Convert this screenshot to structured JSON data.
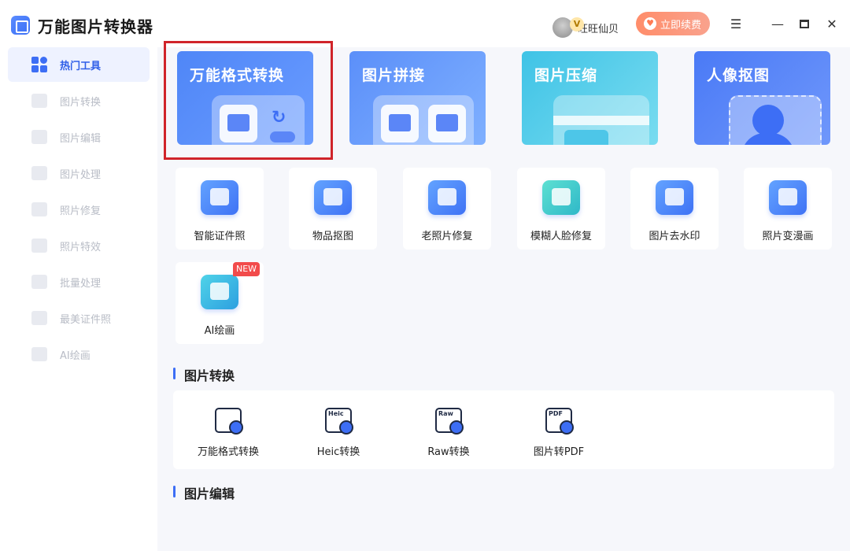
{
  "app": {
    "title": "万能图片转换器"
  },
  "header": {
    "vip_badge": "V",
    "username": "旺旺仙贝",
    "renew_label": "立即续费"
  },
  "sidebar": {
    "items": [
      {
        "label": "热门工具",
        "icon": "grid-icon",
        "active": true
      },
      {
        "label": "图片转换",
        "icon": "image-convert-icon"
      },
      {
        "label": "图片编辑",
        "icon": "image-edit-icon"
      },
      {
        "label": "图片处理",
        "icon": "image-process-icon"
      },
      {
        "label": "照片修复",
        "icon": "photo-repair-icon"
      },
      {
        "label": "照片特效",
        "icon": "photo-effect-icon"
      },
      {
        "label": "批量处理",
        "icon": "batch-icon"
      },
      {
        "label": "最美证件照",
        "icon": "id-photo-icon"
      },
      {
        "label": "AI绘画",
        "icon": "ai-paint-icon"
      }
    ]
  },
  "feature_cards": [
    {
      "title": "万能格式转换",
      "color_from": "#4f86f7",
      "color_to": "#6a9cff"
    },
    {
      "title": "图片拼接",
      "color_from": "#5b8ff9",
      "color_to": "#7fb0ff"
    },
    {
      "title": "图片压缩",
      "color_from": "#3fc3e6",
      "color_to": "#79dcf0"
    },
    {
      "title": "人像抠图",
      "color_from": "#4a7af6",
      "color_to": "#6f97fb"
    }
  ],
  "tools": [
    {
      "label": "智能证件照"
    },
    {
      "label": "物品抠图"
    },
    {
      "label": "老照片修复"
    },
    {
      "label": "模糊人脸修复"
    },
    {
      "label": "图片去水印"
    },
    {
      "label": "照片变漫画"
    },
    {
      "label": "AI绘画",
      "badge": "NEW"
    }
  ],
  "sections": {
    "convert_title": "图片转换",
    "edit_title": "图片编辑"
  },
  "convert_items": [
    {
      "label": "万能格式转换",
      "tag": ""
    },
    {
      "label": "Heic转换",
      "tag": "Heic"
    },
    {
      "label": "Raw转换",
      "tag": "Raw"
    },
    {
      "label": "图片转PDF",
      "tag": "PDF"
    }
  ]
}
